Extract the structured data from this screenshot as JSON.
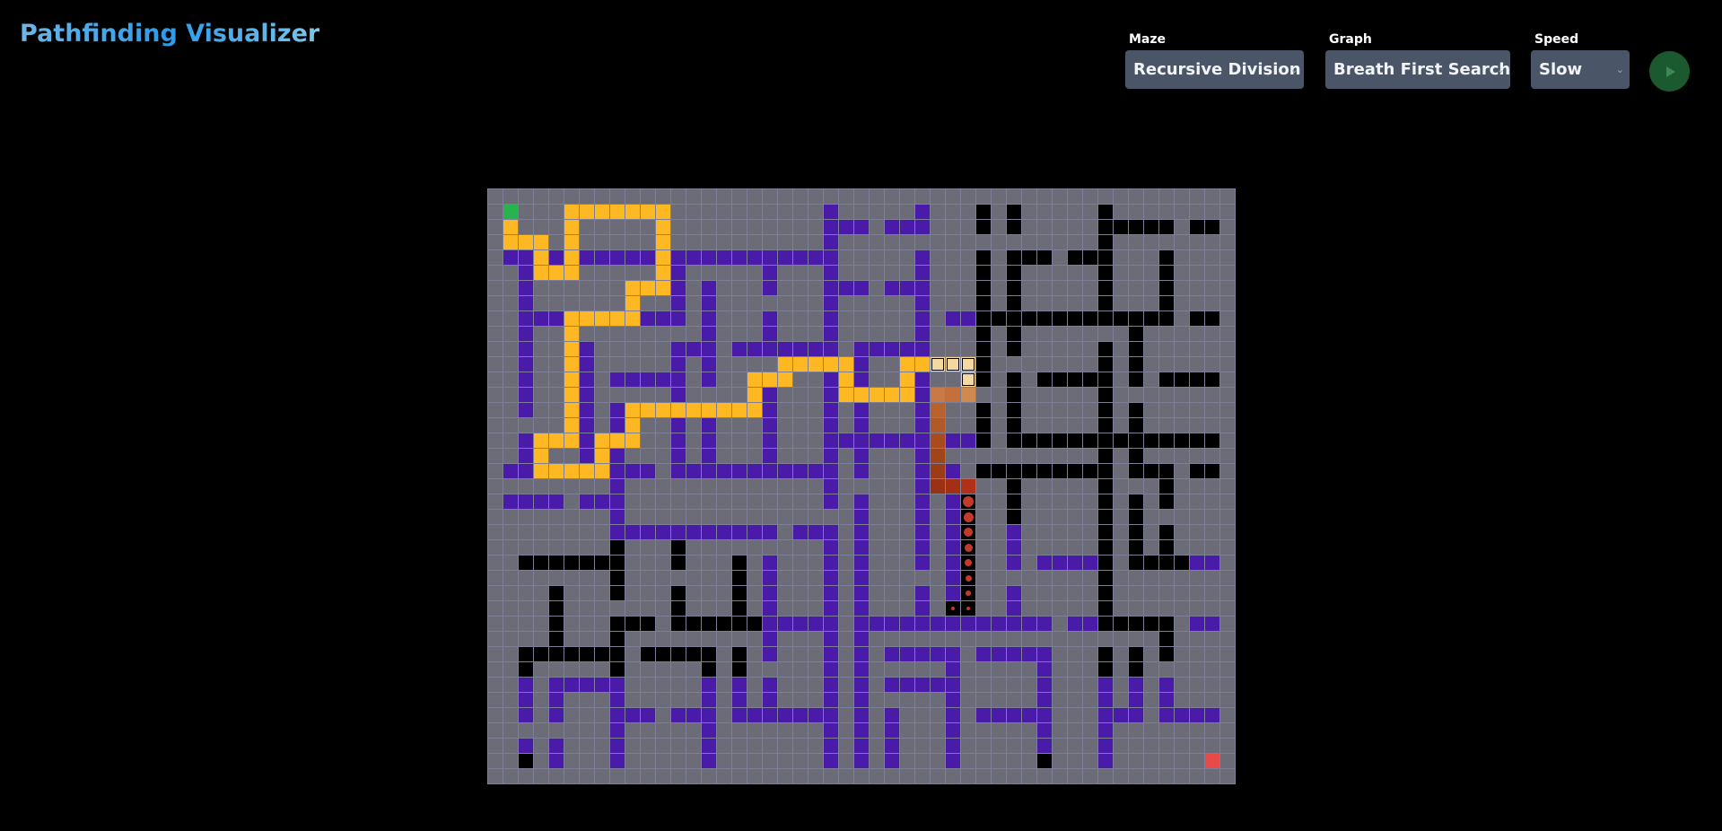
{
  "app": {
    "title": "Pathfinding Visualizer"
  },
  "controls": {
    "maze": {
      "label": "Maze",
      "value": "Recursive Division"
    },
    "graph": {
      "label": "Graph",
      "value": "Breath First Search"
    },
    "speed": {
      "label": "Speed",
      "value": "Slow"
    },
    "run_icon": "play-icon"
  },
  "colors": {
    "background": "#000000",
    "cell": "#6b6c78",
    "grid_line": "#7d7f97",
    "visited_wall": "#4a1aa8",
    "unvisited_wall": "#000000",
    "path": "#fdb823",
    "start": "#27b44f",
    "end": "#e84a4a",
    "frontier_dot": "#c43a2a",
    "run_button": "#1b5a2e"
  }
}
